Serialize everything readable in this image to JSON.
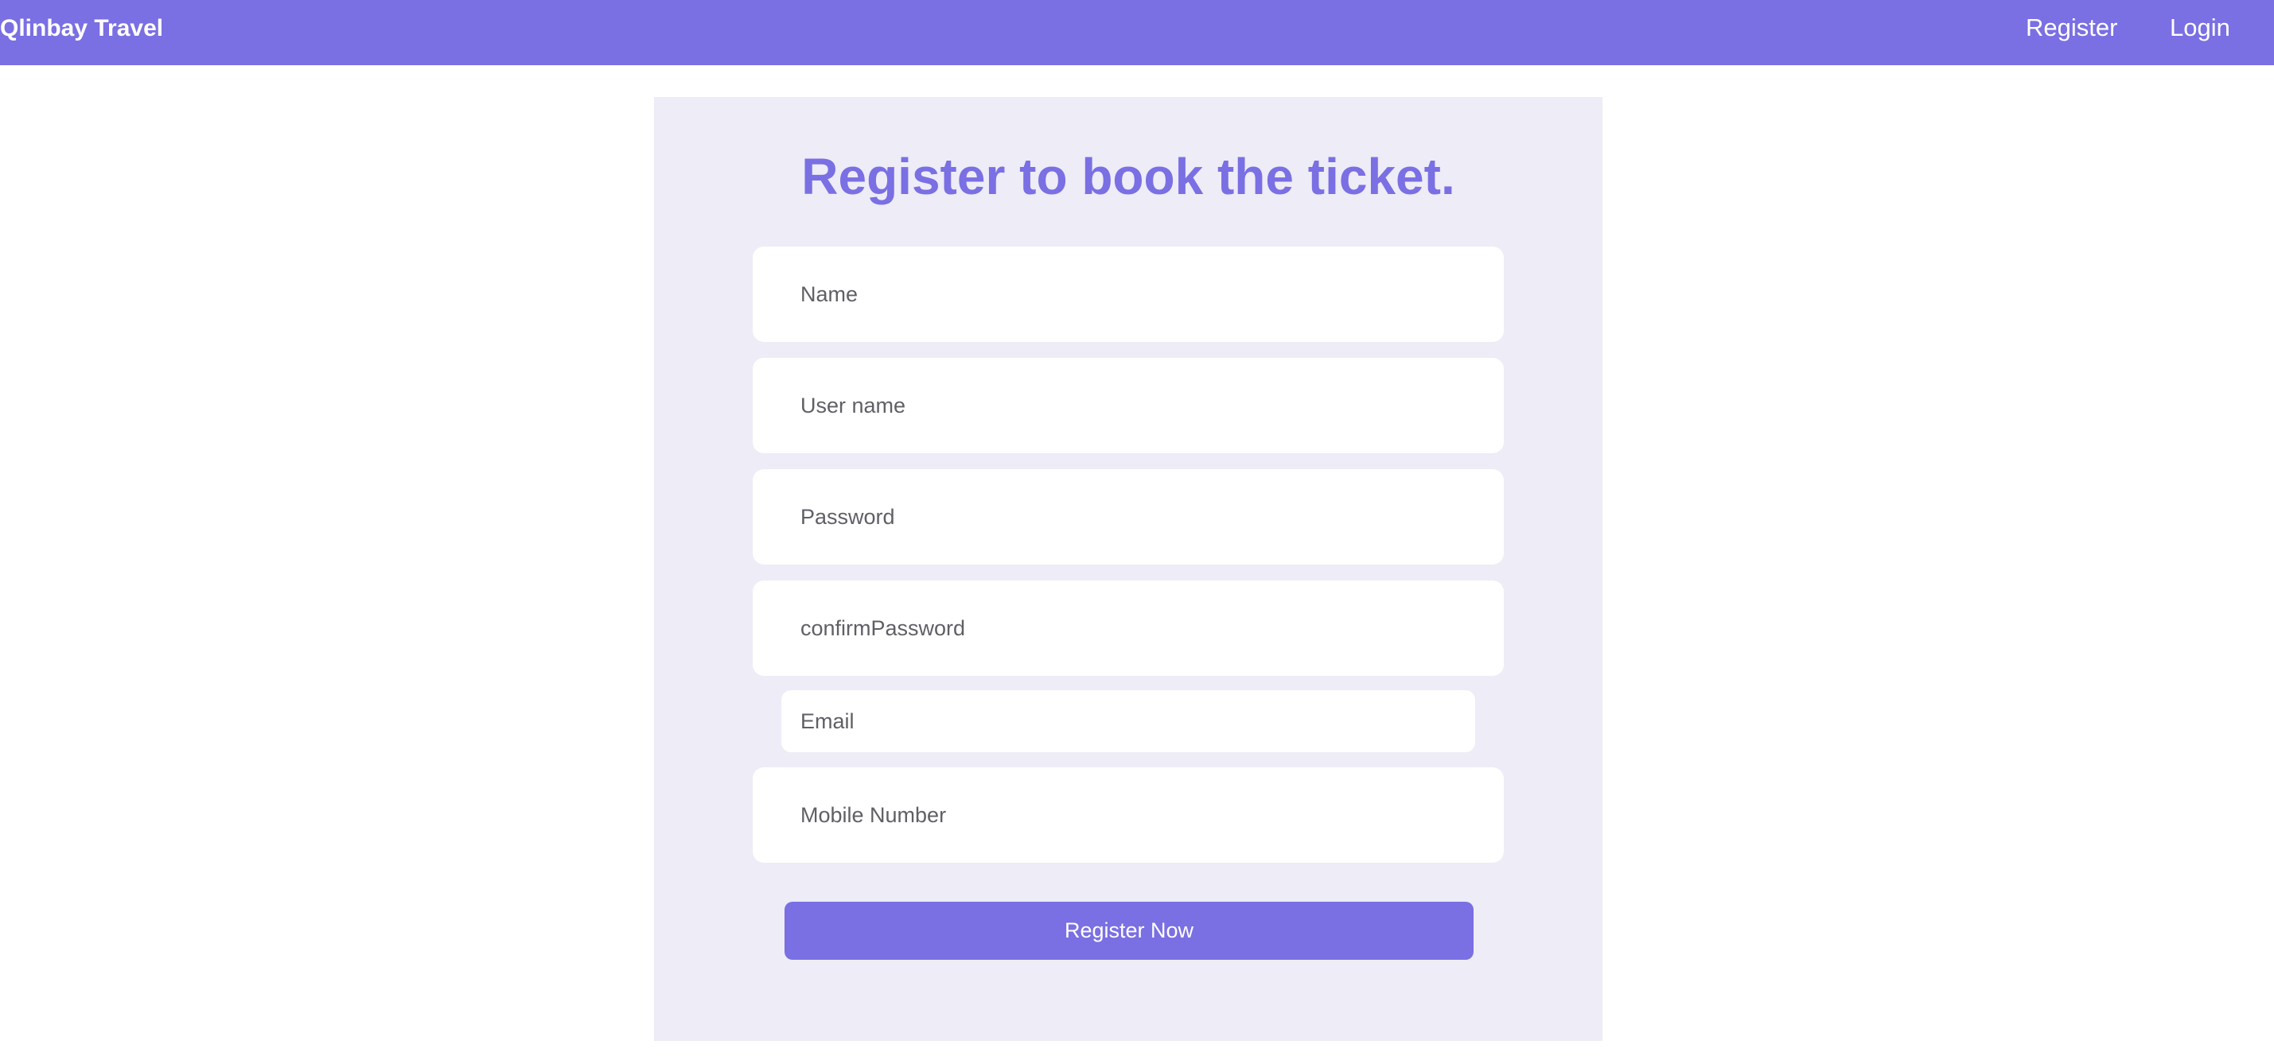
{
  "navbar": {
    "brand": "Qlinbay Travel",
    "links": [
      {
        "label": "Register"
      },
      {
        "label": "Login"
      }
    ]
  },
  "form": {
    "title": "Register to book the ticket.",
    "fields": {
      "name": {
        "placeholder": "Name",
        "value": ""
      },
      "username": {
        "placeholder": "User name",
        "value": ""
      },
      "password": {
        "placeholder": "Password",
        "value": ""
      },
      "confirm_password": {
        "placeholder": "confirmPassword",
        "value": ""
      },
      "email": {
        "placeholder": "Email",
        "value": ""
      },
      "mobile": {
        "placeholder": "Mobile Number",
        "value": ""
      }
    },
    "submit_label": "Register Now"
  },
  "colors": {
    "accent": "#7a6fe3",
    "card_background": "#edecf7",
    "page_background": "#ffffff"
  }
}
